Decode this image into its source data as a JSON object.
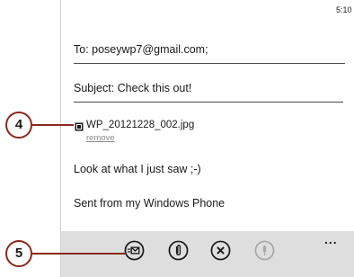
{
  "status_bar": {
    "time": "5:10"
  },
  "compose": {
    "to_line": "To:  poseywp7@gmail.com;",
    "subject_line": "Subject:  Check this out!",
    "attachment": {
      "icon": "image-attachment-icon",
      "file_name": "WP_20121228_002.jpg",
      "remove_label": "remove"
    },
    "body_lines": [
      "Look at what I just saw ;-)",
      "Sent from my Windows Phone"
    ]
  },
  "app_bar": {
    "buttons": [
      {
        "icon": "send-icon",
        "enabled": true
      },
      {
        "icon": "attach-icon",
        "enabled": true
      },
      {
        "icon": "delete-icon",
        "enabled": true
      },
      {
        "icon": "microphone-icon",
        "enabled": false
      }
    ],
    "more_label": "..."
  },
  "callouts": {
    "attachment_marker": "4",
    "send_marker": "5"
  },
  "colors": {
    "app_bar_bg": "#dedede",
    "callout_border": "#8a2a1c",
    "disabled_icon": "#a8a8a8",
    "link_gray": "#8a8a8a"
  }
}
